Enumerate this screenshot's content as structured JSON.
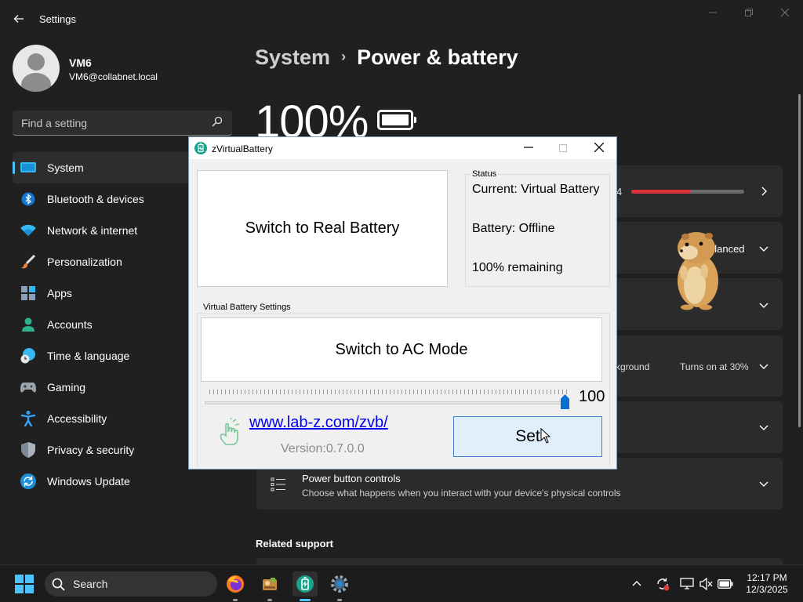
{
  "window": {
    "app_title": "Settings"
  },
  "user": {
    "name": "VM6",
    "email": "VM6@collabnet.local"
  },
  "search": {
    "placeholder": "Find a setting"
  },
  "sidebar": {
    "items": [
      {
        "label": "System",
        "icon": "system-icon",
        "active": true
      },
      {
        "label": "Bluetooth & devices",
        "icon": "bluetooth-icon"
      },
      {
        "label": "Network & internet",
        "icon": "wifi-icon"
      },
      {
        "label": "Personalization",
        "icon": "brush-icon"
      },
      {
        "label": "Apps",
        "icon": "apps-icon"
      },
      {
        "label": "Accounts",
        "icon": "person-icon"
      },
      {
        "label": "Time & language",
        "icon": "globe-clock-icon"
      },
      {
        "label": "Gaming",
        "icon": "gamepad-icon"
      },
      {
        "label": "Accessibility",
        "icon": "accessibility-icon"
      },
      {
        "label": "Privacy & security",
        "icon": "shield-icon"
      },
      {
        "label": "Windows Update",
        "icon": "update-icon"
      }
    ]
  },
  "breadcrumb": {
    "parent": "System",
    "separator": "›",
    "current": "Power & battery"
  },
  "battery": {
    "percent": "100%",
    "level": 1.0
  },
  "cards": {
    "usage_value_partial": "4",
    "usage_bar_fraction": 0.53,
    "power_mode_partial": "alanced",
    "saver_partial": "kground",
    "saver_value": "Turns on at 30%",
    "power_button": {
      "title": "Power button controls",
      "description": "Choose what happens when you interact with your device's physical controls"
    }
  },
  "related": {
    "title": "Related support"
  },
  "dialog": {
    "title": "zVirtualBattery",
    "switch_real_label": "Switch to Real Battery",
    "status_legend": "Status",
    "status_current": "Current: Virtual Battery",
    "status_battery": "Battery: Offline",
    "status_remaining": "100% remaining",
    "vb_legend": "Virtual Battery Settings",
    "switch_ac_label": "Switch to AC Mode",
    "slider_value": "100",
    "slider_fraction": 1.0,
    "link": "www.lab-z.com/zvb/",
    "version": "Version:0.7.0.0",
    "set_label": "Set"
  },
  "taskbar": {
    "search_label": "Search",
    "apps": [
      "firefox-icon",
      "game-app-icon",
      "zvirtualbattery-icon",
      "settings-gear-icon"
    ],
    "clock_time": "12:17 PM",
    "clock_date": "12/3/2025"
  },
  "colors": {
    "accent": "#4cc2ff",
    "usage_bar": "#d9323b",
    "dialog_bg": "#f0f0f0",
    "link": "#0000ee"
  }
}
